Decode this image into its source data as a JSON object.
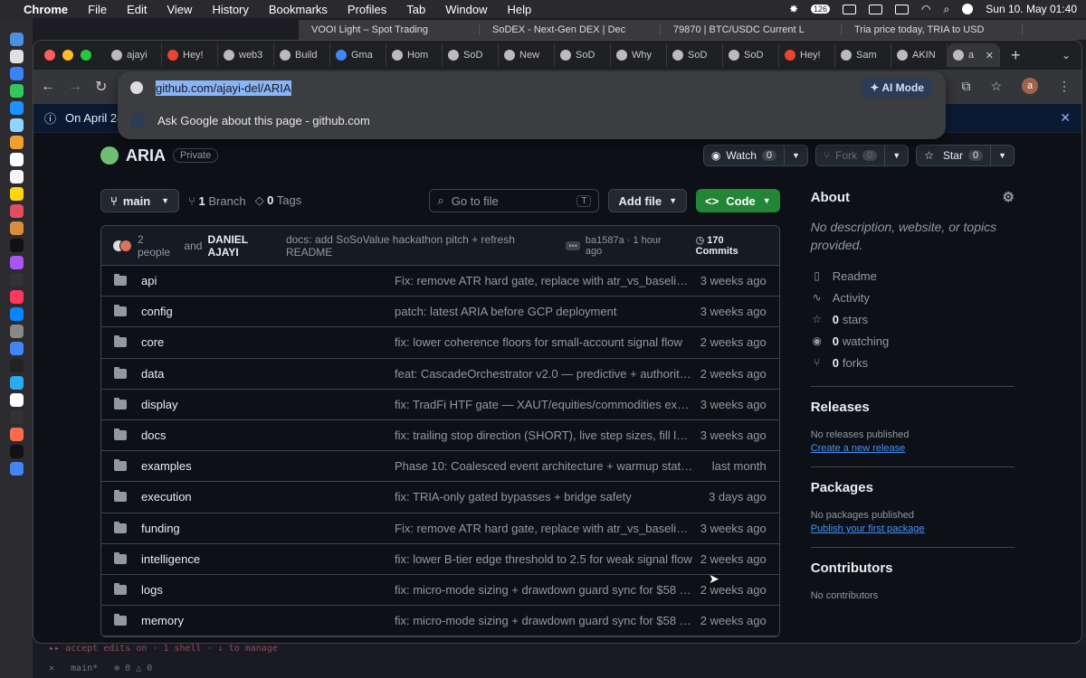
{
  "menubar": {
    "app": "Chrome",
    "items": [
      "File",
      "Edit",
      "View",
      "History",
      "Bookmarks",
      "Profiles",
      "Tab",
      "Window",
      "Help"
    ],
    "clock": "Sun 10. May  01:40",
    "battery_badge": "126"
  },
  "behind_tabs": [
    "VOOI Light – Spot Trading",
    "SoDEX - Next-Gen DEX | Dec",
    "79870 | BTC/USDC Current L",
    "Tria price today, TRIA to USD"
  ],
  "tabs": [
    {
      "label": "ajayi"
    },
    {
      "label": "Hey!"
    },
    {
      "label": "web3"
    },
    {
      "label": "Build"
    },
    {
      "label": "Gma"
    },
    {
      "label": "Hom"
    },
    {
      "label": "SoD"
    },
    {
      "label": "New"
    },
    {
      "label": "SoD"
    },
    {
      "label": "Why"
    },
    {
      "label": "SoD"
    },
    {
      "label": "SoD"
    },
    {
      "label": "Hey!"
    },
    {
      "label": "Sam"
    },
    {
      "label": "AKIN"
    }
  ],
  "active_tab_label": "a",
  "omnibox": {
    "url": "github.com/ajayi-del/ARIA",
    "suggestion": "Ask Google about this page - github.com",
    "ai_mode": "AI Mode",
    "profile_initial": "a"
  },
  "banner": {
    "text": "On April 24"
  },
  "repo": {
    "name": "ARIA",
    "visibility": "Private",
    "watch_label": "Watch",
    "watch_count": "0",
    "fork_label": "Fork",
    "fork_count": "0",
    "star_label": "Star",
    "star_count": "0"
  },
  "controls": {
    "branch": "main",
    "branch_count": "1",
    "branch_label": "Branch",
    "tag_count": "0",
    "tag_label": "Tags",
    "goto_placeholder": "Go to file",
    "goto_key": "T",
    "add_file": "Add file",
    "code": "Code"
  },
  "commit": {
    "people": "2 people",
    "and": "and",
    "author": "DANIEL AJAYI",
    "message": "docs: add SoSoValue hackathon pitch + refresh README",
    "hash": "ba1587a · 1 hour ago",
    "commits": "170 Commits"
  },
  "files": [
    {
      "name": "api",
      "message": "Fix: remove ATR hard gate, replace with atr_vs_baseline ra...",
      "date": "3 weeks ago"
    },
    {
      "name": "config",
      "message": "patch: latest ARIA before GCP deployment",
      "date": "3 weeks ago"
    },
    {
      "name": "core",
      "message": "fix: lower coherence floors for small-account signal flow",
      "date": "2 weeks ago"
    },
    {
      "name": "data",
      "message": "feat: CascadeOrchestrator v2.0 — predictive + authoritativ...",
      "date": "2 weeks ago"
    },
    {
      "name": "display",
      "message": "fix: TradFi HTF gate — XAUT/equities/commodities exempt...",
      "date": "3 weeks ago"
    },
    {
      "name": "docs",
      "message": "fix: trailing stop direction (SHORT), live step sizes, fill laten...",
      "date": "3 weeks ago"
    },
    {
      "name": "examples",
      "message": "Phase 10: Coalesced event architecture + warmup state m...",
      "date": "last month"
    },
    {
      "name": "execution",
      "message": "fix: TRIA-only gated bypasses + bridge safety",
      "date": "3 days ago"
    },
    {
      "name": "funding",
      "message": "Fix: remove ATR hard gate, replace with atr_vs_baseline ra...",
      "date": "3 weeks ago"
    },
    {
      "name": "intelligence",
      "message": "fix: lower B-tier edge threshold to 2.5 for weak signal flow",
      "date": "2 weeks ago"
    },
    {
      "name": "logs",
      "message": "fix: micro-mode sizing + drawdown guard sync for $58 rel...",
      "date": "2 weeks ago"
    },
    {
      "name": "memory",
      "message": "fix: micro-mode sizing + drawdown guard sync for $58 rel...",
      "date": "2 weeks ago"
    }
  ],
  "about": {
    "title": "About",
    "description": "No description, website, or topics provided.",
    "readme": "Readme",
    "activity": "Activity",
    "stars_n": "0",
    "stars": "stars",
    "watching_n": "0",
    "watching": "watching",
    "forks_n": "0",
    "forks": "forks"
  },
  "releases": {
    "title": "Releases",
    "empty": "No releases published",
    "link": "Create a new release"
  },
  "packages": {
    "title": "Packages",
    "empty": "No packages published",
    "link": "Publish your first package"
  },
  "contributors": {
    "title": "Contributors",
    "empty": "No contributors"
  },
  "terminal": {
    "line1": "▸▸ accept edits on · 1 shell · ↓ to manage",
    "branch": "main*",
    "status": "⊗ 0 △ 0"
  },
  "colors": {
    "accent_green": "#238636",
    "link_blue": "#4493f8",
    "bg": "#0d1117"
  }
}
